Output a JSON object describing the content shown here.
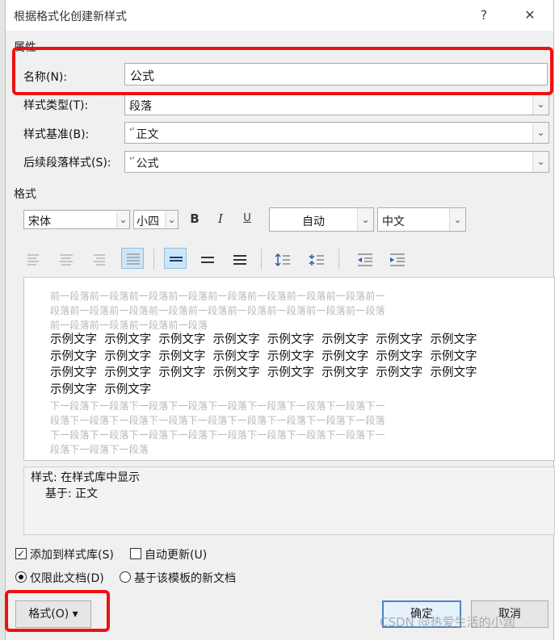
{
  "window": {
    "title": "根据格式化创建新样式",
    "help_label": "?",
    "close_label": "✕"
  },
  "properties": {
    "section_label": "属性",
    "name": {
      "label": "名称(N):",
      "value": "公式"
    },
    "style_type": {
      "label": "样式类型(T):",
      "value": "段落"
    },
    "based_on": {
      "label": "样式基准(B):",
      "value": "正文"
    },
    "next_style": {
      "label": "后续段落样式(S):",
      "value": "公式"
    }
  },
  "formatting": {
    "section_label": "格式",
    "font": "宋体",
    "size": "小四",
    "bold_label": "B",
    "italic_label": "I",
    "underline_label": "U",
    "color": "自动",
    "script": "中文"
  },
  "preview": {
    "prev_lines": [
      "前一段落前一段落前一段落前一段落前一段落前一段落前一段落前一段落前一",
      "段落前一段落前一段落前一段落前一段落前一段落前一段落前一段落前一段落",
      "前一段落前一段落前一段落前一段落"
    ],
    "sample_lines": [
      "示例文字  示例文字  示例文字  示例文字  示例文字  示例文字  示例文字  示例文字",
      "示例文字  示例文字  示例文字  示例文字  示例文字  示例文字  示例文字  示例文字",
      "示例文字  示例文字  示例文字  示例文字  示例文字  示例文字  示例文字  示例文字",
      "示例文字  示例文字"
    ],
    "next_lines": [
      "下一段落下一段落下一段落下一段落下一段落下一段落下一段落下一段落下一",
      "段落下一段落下一段落下一段落下一段落下一段落下一段落下一段落下一段落",
      "下一段落下一段落下一段落下一段落下一段落下一段落下一段落下一段落下一",
      "段落下一段落下一段落"
    ]
  },
  "description": {
    "line1": "样式: 在样式库中显示",
    "line2": "基于: 正文"
  },
  "options": {
    "add_to_gallery": {
      "label": "添加到样式库(S)",
      "checked": true
    },
    "auto_update": {
      "label": "自动更新(U)",
      "checked": false
    },
    "only_this_doc": {
      "label": "仅限此文档(D)",
      "selected": true
    },
    "template_docs": {
      "label": "基于该模板的新文档",
      "selected": false
    }
  },
  "buttons": {
    "format_label": "格式(O) ▾",
    "ok_label": "确定",
    "cancel_label": "取消"
  },
  "watermark": "CSDN @热爱生活的小润",
  "colors": {
    "highlight_box": "#ee1111",
    "default_button_border": "#4a86c9"
  }
}
